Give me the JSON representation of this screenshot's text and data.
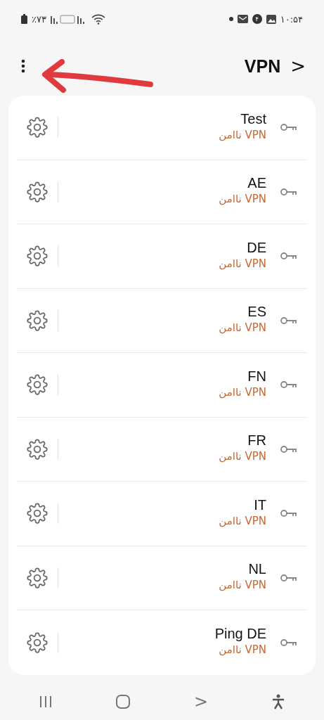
{
  "status_bar": {
    "battery": "٪۷۳",
    "notification_count": "۴",
    "time": "۱۰:۵۴"
  },
  "header": {
    "title": "VPN",
    "back": ">"
  },
  "vpns": [
    {
      "name": "Test",
      "status": "VPN ناامن"
    },
    {
      "name": "AE",
      "status": "VPN ناامن"
    },
    {
      "name": "DE",
      "status": "VPN ناامن"
    },
    {
      "name": "ES",
      "status": "VPN ناامن"
    },
    {
      "name": "FN",
      "status": "VPN ناامن"
    },
    {
      "name": "FR",
      "status": "VPN ناامن"
    },
    {
      "name": "IT",
      "status": "VPN ناامن"
    },
    {
      "name": "NL",
      "status": "VPN ناامن"
    },
    {
      "name": "Ping DE",
      "status": "VPN ناامن"
    }
  ],
  "nav_bar": {
    "forward": ">"
  }
}
